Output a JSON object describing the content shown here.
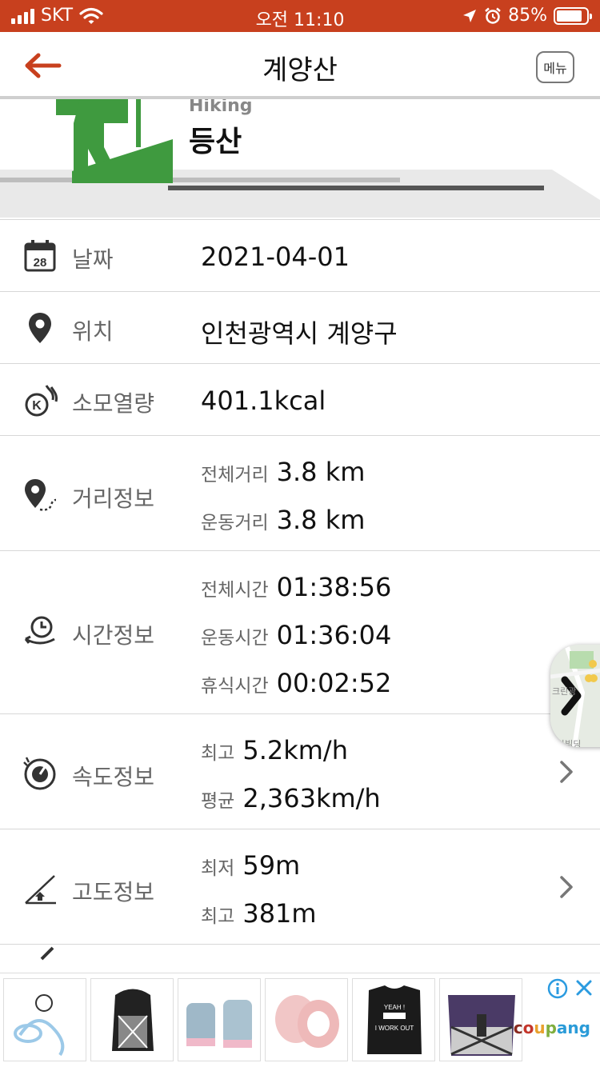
{
  "status_bar": {
    "carrier": "SKT",
    "time": "오전 11:10",
    "battery": "85%",
    "battery_level": 0.85
  },
  "nav": {
    "title": "계양산",
    "menu_label": "메뉴"
  },
  "activity": {
    "name_en": "Hiking",
    "name_ko": "등산"
  },
  "rows": {
    "date": {
      "label": "날짜",
      "value": "2021-04-01"
    },
    "location": {
      "label": "위치",
      "value": "인천광역시 계양구"
    },
    "calories": {
      "label": "소모열량",
      "value": "401.1kcal"
    },
    "distance": {
      "label": "거리정보",
      "total_key": "전체거리",
      "total_value": "3.8 km",
      "exercise_key": "운동거리",
      "exercise_value": "3.8 km"
    },
    "time": {
      "label": "시간정보",
      "total_key": "전체시간",
      "total_value": "01:38:56",
      "exercise_key": "운동시간",
      "exercise_value": "01:36:04",
      "rest_key": "휴식시간",
      "rest_value": "00:02:52"
    },
    "speed": {
      "label": "속도정보",
      "max_key": "최고",
      "max_value": "5.2km/h",
      "avg_key": "평균",
      "avg_value": "2,363km/h"
    },
    "altitude": {
      "label": "고도정보",
      "min_key": "최저",
      "min_value": "59m",
      "max_key": "최고",
      "max_value": "381m"
    }
  },
  "calendar_day": "28",
  "calorie_badge": "K",
  "map_tab": {
    "line1": "크린광",
    "line2": "라빌딩"
  },
  "ad": {
    "brand": "coupang",
    "items": [
      "harness-leash",
      "black-houndstooth-harness",
      "blue-dog-shoes",
      "pink-dog-hats",
      "black-dog-shirt",
      "purple-houndstooth-harness"
    ],
    "shirt_text_1": "YEAH !",
    "shirt_text_2": "I WORK OUT"
  },
  "colors": {
    "accent": "#c8401e",
    "hiker_green": "#3f9a3f"
  }
}
